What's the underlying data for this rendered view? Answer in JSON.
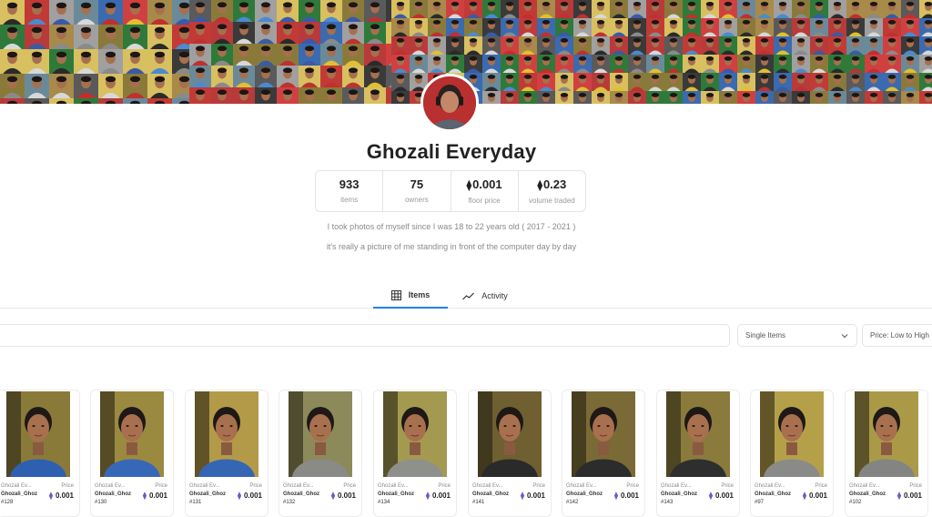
{
  "collection": {
    "title": "Ghozali Everyday",
    "description": [
      "I took photos of myself since I was 18 to 22 years old ( 2017 - 2021 )",
      "it's really a picture of me standing in front of the computer day by day"
    ],
    "stats": [
      {
        "value": "933",
        "label": "items",
        "eth": false
      },
      {
        "value": "75",
        "label": "owners",
        "eth": false
      },
      {
        "value": "0.001",
        "label": "floor price",
        "eth": true
      },
      {
        "value": "0.23",
        "label": "volume traded",
        "eth": true
      }
    ]
  },
  "tabs": [
    {
      "label": "Items",
      "icon": "grid-icon",
      "active": true
    },
    {
      "label": "Activity",
      "icon": "activity-icon",
      "active": false
    }
  ],
  "filters": {
    "search_value": "",
    "item_type": "Single Items",
    "sort": "Price: Low to High"
  },
  "colors": {
    "accent": "#2081e2",
    "eth": "#6a5acd"
  },
  "cards": [
    {
      "collection": "Ghozali Ev...",
      "short": "Ghozali_Ghoz",
      "number": "#128",
      "price_label": "Price",
      "price": "0.001",
      "shirt": "#2f5fb0",
      "bg": "#8a7a3a"
    },
    {
      "collection": "Ghozali Ev...",
      "short": "Ghozali_Ghoz",
      "number": "#130",
      "price_label": "Price",
      "price": "0.001",
      "shirt": "#3768b8",
      "bg": "#9a8a40"
    },
    {
      "collection": "Ghozali Ev...",
      "short": "Ghozali_Ghoz",
      "number": "#131",
      "price_label": "Price",
      "price": "0.001",
      "shirt": "#3566b4",
      "bg": "#b39a48"
    },
    {
      "collection": "Ghozali Ev...",
      "short": "Ghozali_Ghoz",
      "number": "#132",
      "price_label": "Price",
      "price": "0.001",
      "shirt": "#8a8a86",
      "bg": "#8c8a5a"
    },
    {
      "collection": "Ghozali Ev...",
      "short": "Ghozali_Ghoz",
      "number": "#134",
      "price_label": "Price",
      "price": "0.001",
      "shirt": "#8e908c",
      "bg": "#a39a50"
    },
    {
      "collection": "Ghozali Ev...",
      "short": "Ghozali_Ghoz",
      "number": "#141",
      "price_label": "Price",
      "price": "0.001",
      "shirt": "#2a2a2a",
      "bg": "#6e6030"
    },
    {
      "collection": "Ghozali Ev...",
      "short": "Ghozali_Ghoz",
      "number": "#142",
      "price_label": "Price",
      "price": "0.001",
      "shirt": "#2c2c2c",
      "bg": "#7a6a36"
    },
    {
      "collection": "Ghozali Ev...",
      "short": "Ghozali_Ghoz",
      "number": "#143",
      "price_label": "Price",
      "price": "0.001",
      "shirt": "#2e2e2e",
      "bg": "#8a7a3c"
    },
    {
      "collection": "Ghozali Ev...",
      "short": "Ghozali_Ghoz",
      "number": "#97",
      "price_label": "Price",
      "price": "0.001",
      "shirt": "#8a8a88",
      "bg": "#b5a04a"
    },
    {
      "collection": "Ghozali Ev...",
      "short": "Ghozali_Ghoz",
      "number": "#102",
      "price_label": "Price",
      "price": "0.001",
      "shirt": "#848482",
      "bg": "#aa9a48"
    }
  ]
}
